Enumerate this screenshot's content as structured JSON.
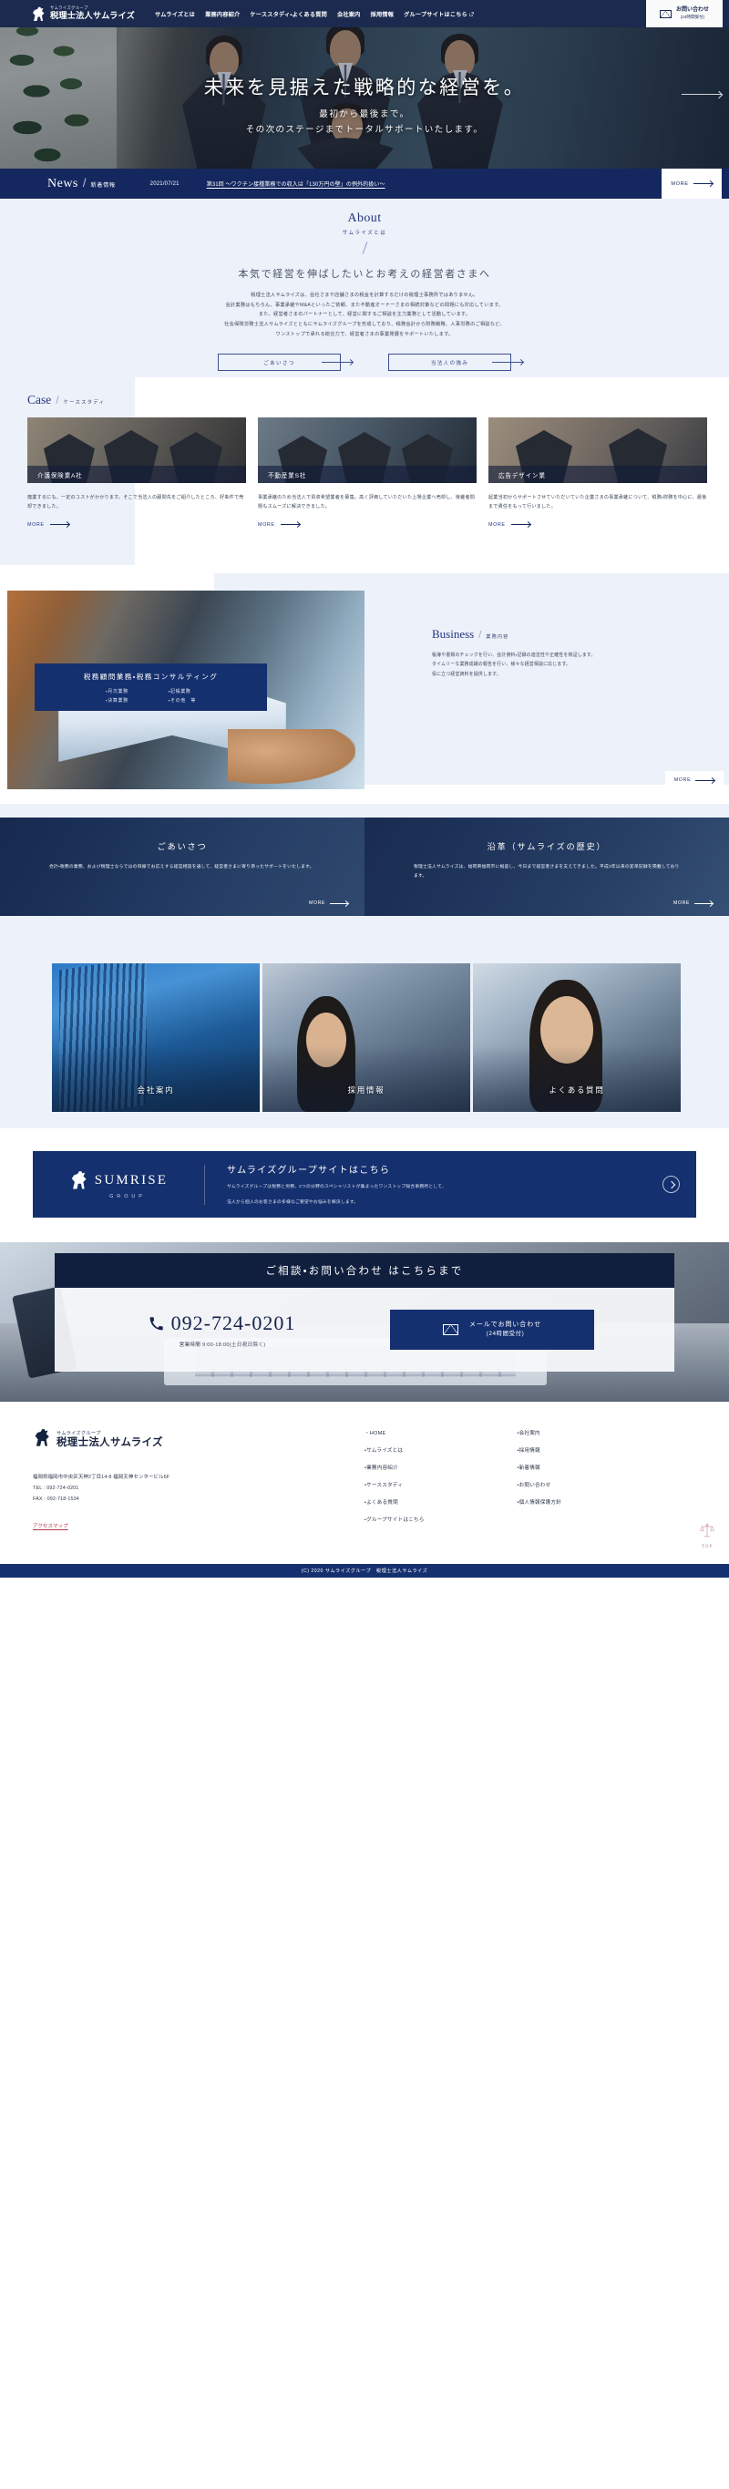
{
  "header": {
    "logo_sub": "サムライズグループ",
    "logo_main": "税理士法人サムライズ",
    "nav": [
      {
        "label": "サムライズとは",
        "external": false
      },
      {
        "label": "業務内容紹介",
        "external": false
      },
      {
        "label": "ケーススタディ・よくある質問",
        "external": false
      },
      {
        "label": "会社案内",
        "external": false
      },
      {
        "label": "採用情報",
        "external": false
      },
      {
        "label": "グループサイトはこちら",
        "external": true
      }
    ],
    "contact_button": {
      "line1": "お問い合わせ",
      "line2": "(24時間受付)",
      "icon": "mail-icon"
    }
  },
  "hero": {
    "headline": "未来を見据えた戦略的な経営を。",
    "sub1": "最初から最後まで。",
    "sub2": "その次のステージまでトータルサポートいたします。"
  },
  "news": {
    "en": "News",
    "slash": "/",
    "jp": "新着情報",
    "date": "2021/07/21",
    "title": "第31回 ～ワクチン接種業務での収入は「130万円の壁」の例外的扱い～",
    "more": "MORE"
  },
  "about": {
    "en": "About",
    "jp": "サムライズとは",
    "lead": "本気で経営を伸ばしたいとお考えの経営者さまへ",
    "paragraphs": [
      "税理士法人サムライズは、会社さまや店舗さまの税金を計算するだけの税理士事務所ではありません。",
      "会計業務はもちろん、事業承継やM&Aといったご依頼、また不動産オーナーさまの相続対策などの問題にも対応しています。",
      "また、経営者さまのパートナーとして、経営に関するご相談を主力業務として活動しています。",
      "社会保険労務士法人サムライズとともにサムライズグループを形成しており、税務会計から財務戦略、人事労務のご相談など、",
      "ワンストップで承れる総合力で、経営者さまの事業発展をサポートいたします。"
    ],
    "buttons": [
      {
        "label": "ごあいさつ"
      },
      {
        "label": "当法人の強み"
      }
    ]
  },
  "case": {
    "en": "Case",
    "slash": "/",
    "jp": "ケーススタディ",
    "cards": [
      {
        "caption": "介護保険業A社",
        "text": "廃業するにも、一定のコストがかかります。そこで当法人の顧問先をご紹介したところ、好条件で売却できました。",
        "more": "MORE"
      },
      {
        "caption": "不動産業S社",
        "text": "事業承継のため当法人で買収希望業者を募集。高く評価していただいた上場企業へ売却し、後継者問題もスムーズに解決できました。",
        "more": "MORE"
      },
      {
        "caption": "広告デザイン業",
        "text": "起業当初からサポートさせていただいていた企業さまの事業承継について、税務・財務を中心に、最後まで責任をもって行いました。",
        "more": "MORE"
      }
    ]
  },
  "business": {
    "en": "Business",
    "slash": "/",
    "jp": "業務内容",
    "body": [
      "帳簿や書類のチェックを行い、会計資料・記録の適法性や正確性を検証します。",
      "タイムリーな業務成績の報告を行い、様々な経営相談に応じます。",
      "役に立つ経営資料を提供します。"
    ],
    "card_title": "税務顧問業務・税務コンサルティング",
    "items_left": [
      "・月次業務",
      "・決算業務"
    ],
    "items_right": [
      "・記帳業務",
      "・その他　等"
    ],
    "more": "MORE"
  },
  "greeting_history": [
    {
      "title": "ごあいさつ",
      "text": "会計・税務の業務、および税理士ならではの目線でお応えする経営相談を通して、経営者さまに寄り添ったサポートをいたします。",
      "more": "MORE"
    },
    {
      "title": "沿革（サムライズの歴史）",
      "text": "税理士法人サムライズは、福岡県福岡市に根差し、今日まで経営者さまを支えてきました。平成3年以来の変革記録を掲載しております。",
      "more": "MORE"
    }
  ],
  "trio": [
    {
      "caption": "会社案内"
    },
    {
      "caption": "採用情報"
    },
    {
      "caption": "よくある質問"
    }
  ],
  "group_banner": {
    "logo_name": "SUMRISE",
    "logo_sub": "GROUP",
    "title": "サムライズグループサイトはこちら",
    "desc1": "サムライズグループは税務と労務、2つの分野のスペシャリストが集まったワンストップ総合事務所として、",
    "desc2": "法人から個人のお客さまの多様なご要望やお悩みを解決します。"
  },
  "cta": {
    "bar_title": "ご相談・お問い合わせ はこちらまで",
    "tel": "092-724-0201",
    "hours": "営業時間 9:00-18:00(土日祝日除く)",
    "mail_line1": "メールでお問い合わせ",
    "mail_line2": "(24時間受付)",
    "phone_icon": "phone-icon",
    "mail_icon": "mail-icon"
  },
  "footer": {
    "logo_sub": "サムライズグループ",
    "logo_main": "税理士法人サムライズ",
    "address": "福岡県福岡市中央区天神2丁目14-8 福岡天神センタービル6F",
    "tel": "TEL : 092-724-0201",
    "fax": "FAX : 092-718-1534",
    "access_map": "アクセスマップ",
    "links_col1": [
      "・HOME",
      "・サムライズとは",
      "・業務内容紹介",
      "・ケーススタディ",
      "・よくある質問",
      "・グループサイトはこちら"
    ],
    "links_col2": [
      "・会社案内",
      "・採用情報",
      "・新着情報",
      "・お問い合わせ",
      "・個人情報保護方針"
    ],
    "top_label": "TOP",
    "copyright": "(C) 2020 サムライズグループ　税理士法人サムライズ"
  },
  "colors": {
    "navy": "#15306f",
    "dark_navy": "#101f3e",
    "header_navy": "#1b2a4e",
    "news_navy": "#14275e",
    "light_bg": "#edf1fa",
    "accent_red": "#b03a48"
  }
}
